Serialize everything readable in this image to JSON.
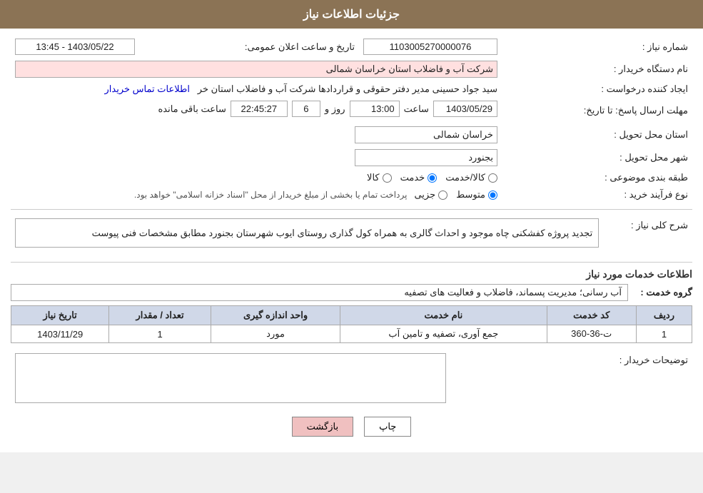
{
  "header": {
    "title": "جزئیات اطلاعات نیاز"
  },
  "fields": {
    "shomareNiaz_label": "شماره نیاز :",
    "shomareNiaz_value": "1103005270000076",
    "namDastgah_label": "نام دستگاه خریدار :",
    "namDastgah_value": "شرکت آب و فاضلاب استان خراسان شمالی",
    "ijadKonande_label": "ایجاد کننده درخواست :",
    "ijadKonande_value": "سید جواد حسینی مدیر دفتر حقوقی و قراردادها  شرکت آب و فاضلاب استان خر",
    "ijadKonande_link": "اطلاعات تماس خریدار",
    "tarikh_label": "تاریخ و ساعت اعلان عمومی:",
    "tarikh_value": "1403/05/22 - 13:45",
    "mohlat_label": "مهلت ارسال پاسخ: تا تاریخ:",
    "mohlat_date": "1403/05/29",
    "mohlat_saat_label": "ساعت",
    "mohlat_saat": "13:00",
    "mohlat_rooz_label": "روز و",
    "mohlat_rooz": "6",
    "mohlat_baghimande_label": "ساعت باقی مانده",
    "mohlat_baghimande": "22:45:27",
    "ostan_label": "استان محل تحویل :",
    "ostan_value": "خراسان شمالی",
    "shahr_label": "شهر محل تحویل :",
    "shahr_value": "بجنورد",
    "tabaqe_label": "طبقه بندی موضوعی :",
    "tabaqe_options": [
      "کالا",
      "خدمت",
      "کالا/خدمت"
    ],
    "tabaqe_selected": "خدمت",
    "noefarayand_label": "نوع فرآیند خرید :",
    "noefarayand_options": [
      "جزیی",
      "متوسط"
    ],
    "noefarayand_selected": "متوسط",
    "noefarayand_note": "پرداخت تمام یا بخشی از مبلغ خریدار از محل \"اسناد خزانه اسلامی\" خواهد بود.",
    "sharh_label": "شرح کلی نیاز :",
    "sharh_value": "تجدید پروژه کفشکنی چاه موجود و احداث گالری به همراه کول گذاری روستای ایوب شهرستان بجنورد مطابق مشخصات فنی پیوست",
    "khadamat_label": "اطلاعات خدمات مورد نیاز",
    "grohe_label": "گروه خدمت :",
    "grohe_value": "آب رسانی؛ مدیریت پسماند، فاضلاب و فعالیت های تصفیه",
    "table_headers": [
      "ردیف",
      "کد خدمت",
      "نام خدمت",
      "واحد اندازه گیری",
      "تعداد / مقدار",
      "تاریخ نیاز"
    ],
    "table_rows": [
      {
        "radif": "1",
        "kod": "ت-36-360",
        "nam": "جمع آوری، تصفیه و تامین آب",
        "vahed": "مورد",
        "tedad": "1",
        "tarikh": "1403/11/29"
      }
    ],
    "toozihat_label": "توضیحات خریدار :",
    "toozihat_value": "",
    "btn_print": "چاپ",
    "btn_back": "بازگشت"
  }
}
